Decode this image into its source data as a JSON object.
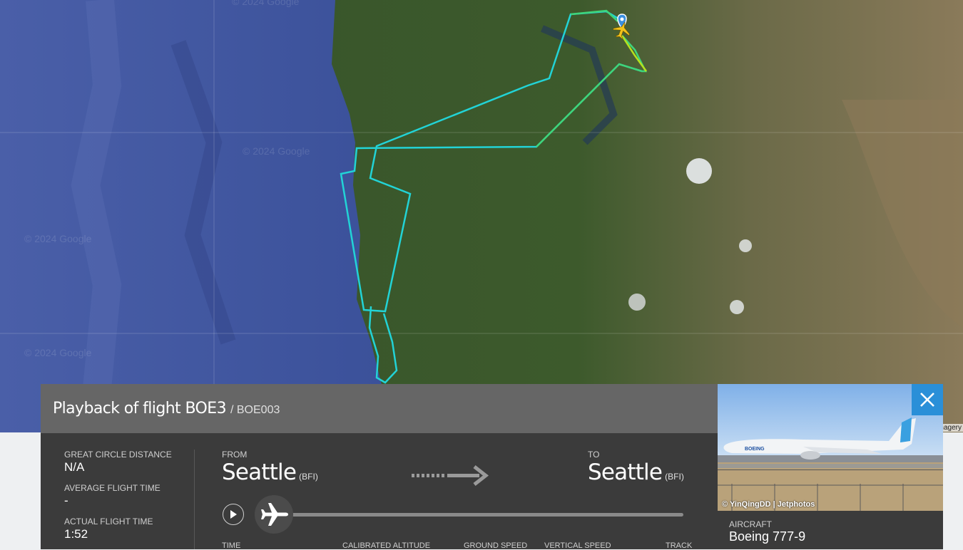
{
  "map": {
    "watermark": "© 2024 Google",
    "imagery_credit": "Imagery",
    "track_colors": {
      "low": "#22d3d6",
      "mid": "#3fd57a",
      "high": "#b6e11d"
    },
    "aircraft_icon": "airplane-icon",
    "pin_icon": "location-pin-icon"
  },
  "panel": {
    "title": "Playback of flight BOE3",
    "callsign": "/ BOE003",
    "stats": [
      {
        "label": "GREAT CIRCLE DISTANCE",
        "value": "N/A"
      },
      {
        "label": "AVERAGE FLIGHT TIME",
        "value": "-"
      },
      {
        "label": "ACTUAL FLIGHT TIME",
        "value": "1:52"
      }
    ],
    "from": {
      "label": "FROM",
      "city": "Seattle",
      "code": "(BFI)"
    },
    "to": {
      "label": "TO",
      "city": "Seattle",
      "code": "(BFI)"
    },
    "columns": [
      "TIME",
      "CALIBRATED ALTITUDE",
      "GROUND SPEED",
      "VERTICAL SPEED",
      "TRACK"
    ],
    "playback_progress": 0.0,
    "accent": "#2a8fd8"
  },
  "photo": {
    "credit": "© YinQingDD | Jetphotos"
  },
  "aircraft": {
    "label": "AIRCRAFT",
    "model": "Boeing 777-9"
  }
}
